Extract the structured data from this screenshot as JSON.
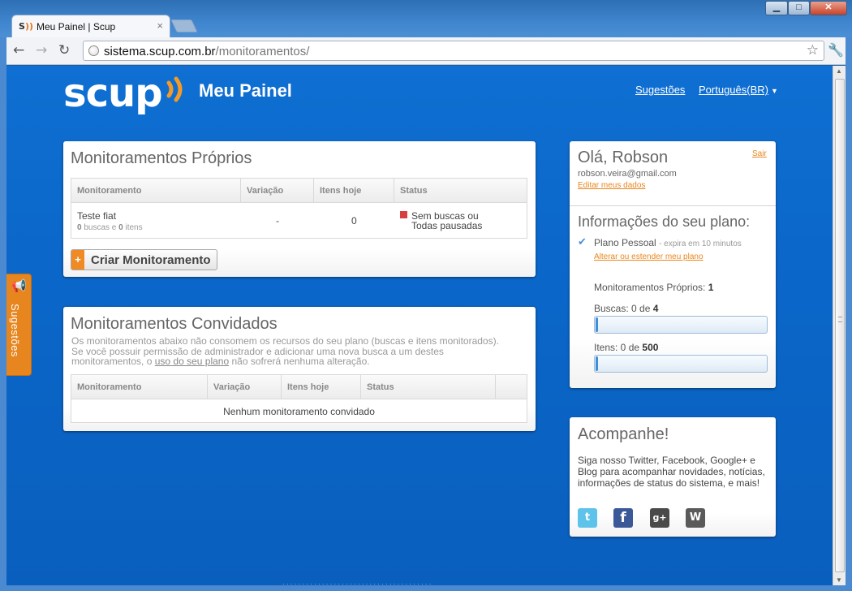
{
  "browser": {
    "tab_title": "Meu Painel | Scup",
    "tab_favicon": "S",
    "url_host": "sistema.scup.com.br",
    "url_path": "/monitoramentos/"
  },
  "header": {
    "logo": "scup",
    "title": "Meu Painel",
    "link_suggestions": "Sugestões",
    "link_language": "Português(BR)"
  },
  "own_monitorings": {
    "title": "Monitoramentos Próprios",
    "columns": [
      "Monitoramento",
      "Variação",
      "Itens hoje",
      "Status"
    ],
    "rows": [
      {
        "name": "Teste fiat",
        "searches": "0",
        "searches_label": "buscas e",
        "items": "0",
        "items_label": "itens",
        "variation": "-",
        "items_today": "0",
        "status_line1": "Sem buscas ou",
        "status_line2": "Todas pausadas"
      }
    ],
    "create_button": "Criar Monitoramento"
  },
  "guest_monitorings": {
    "title": "Monitoramentos Convidados",
    "desc_line1": "Os monitoramentos abaixo não consomem os recursos do seu plano (buscas e itens monitorados).",
    "desc_line2": "Se você possuir permissão de administrador e adicionar uma nova busca a um destes",
    "desc_line3_pre": "monitoramentos, o",
    "desc_link": "uso do seu plano",
    "desc_line3_post": "não sofrerá nenhuma alteração.",
    "columns": [
      "Monitoramento",
      "Variação",
      "Itens hoje",
      "Status"
    ],
    "empty": "Nenhum monitoramento convidado"
  },
  "account": {
    "greeting": "Olá, Robson",
    "email": "robson.veira@gmail.com",
    "edit_link": "Editar meus dados",
    "logout": "Sair",
    "plan_title": "Informações do seu plano:",
    "plan_name": "Plano Pessoal",
    "plan_expiry": "- expira em 10 minutos",
    "plan_link": "Alterar ou estender meu plano",
    "own_label": "Monitoramentos Próprios:",
    "own_count": "1",
    "searches_label": "Buscas: 0 de",
    "searches_max": "4",
    "searches_fraction": 0,
    "items_label": "Itens: 0 de",
    "items_max": "500",
    "items_fraction": 0
  },
  "follow": {
    "title": "Acompanhe!",
    "text": "Siga nosso Twitter, Facebook, Google+ e Blog para acompanhar novidades, notícias, informações de status do sistema, e mais!",
    "icons": [
      "twitter-icon",
      "facebook-icon",
      "google-plus-icon",
      "wordpress-icon"
    ],
    "twitter_glyph": "t",
    "facebook_glyph": "f",
    "google_glyph": "g+",
    "wordpress_glyph": "W"
  },
  "feedback_tab": {
    "label": "Sugestões"
  },
  "colors": {
    "accent": "#e8851e",
    "background": "#0a66c8",
    "status_red": "#d64040"
  }
}
